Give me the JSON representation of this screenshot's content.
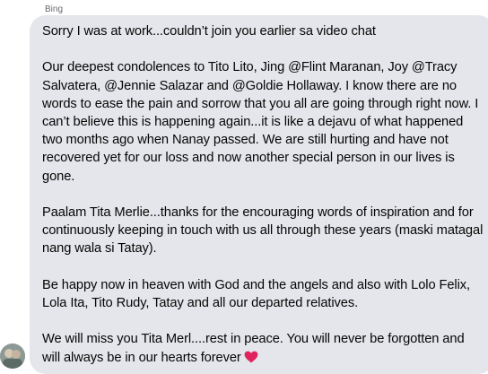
{
  "message": {
    "sender": "Bing",
    "paragraphs": [
      "Sorry I was at work...couldn’t join you earlier sa video chat",
      "Our deepest condolences to Tito Lito, Jing @Flint Maranan, Joy @Tracy Salvatera, @Jennie Salazar and @Goldie Hollaway.  I know there are no words to ease the pain and sorrow that you all are going through right now. I can’t believe this is happening again...it is like a dejavu of what happened two months ago when Nanay passed. We are still hurting and have not recovered yet for our loss and now another special person in our lives is gone.",
      "Paalam Tita Merlie...thanks for the encouraging words of inspiration and for continuously keeping in touch with us all through these years (maski matagal nang wala si Tatay).",
      "Be happy now in heaven with God and the angels and also with Lolo Felix, Lola Ita, Tito Rudy, Tatay and all our departed relatives.",
      "We will miss you Tita Merl....rest in peace. You will never be forgotten and will always be in our hearts forever"
    ],
    "end_emoji": "heart-icon",
    "emoji_color": "#e0245e",
    "bubble_color": "#e4e6eb"
  },
  "avatar_icon": "avatar"
}
